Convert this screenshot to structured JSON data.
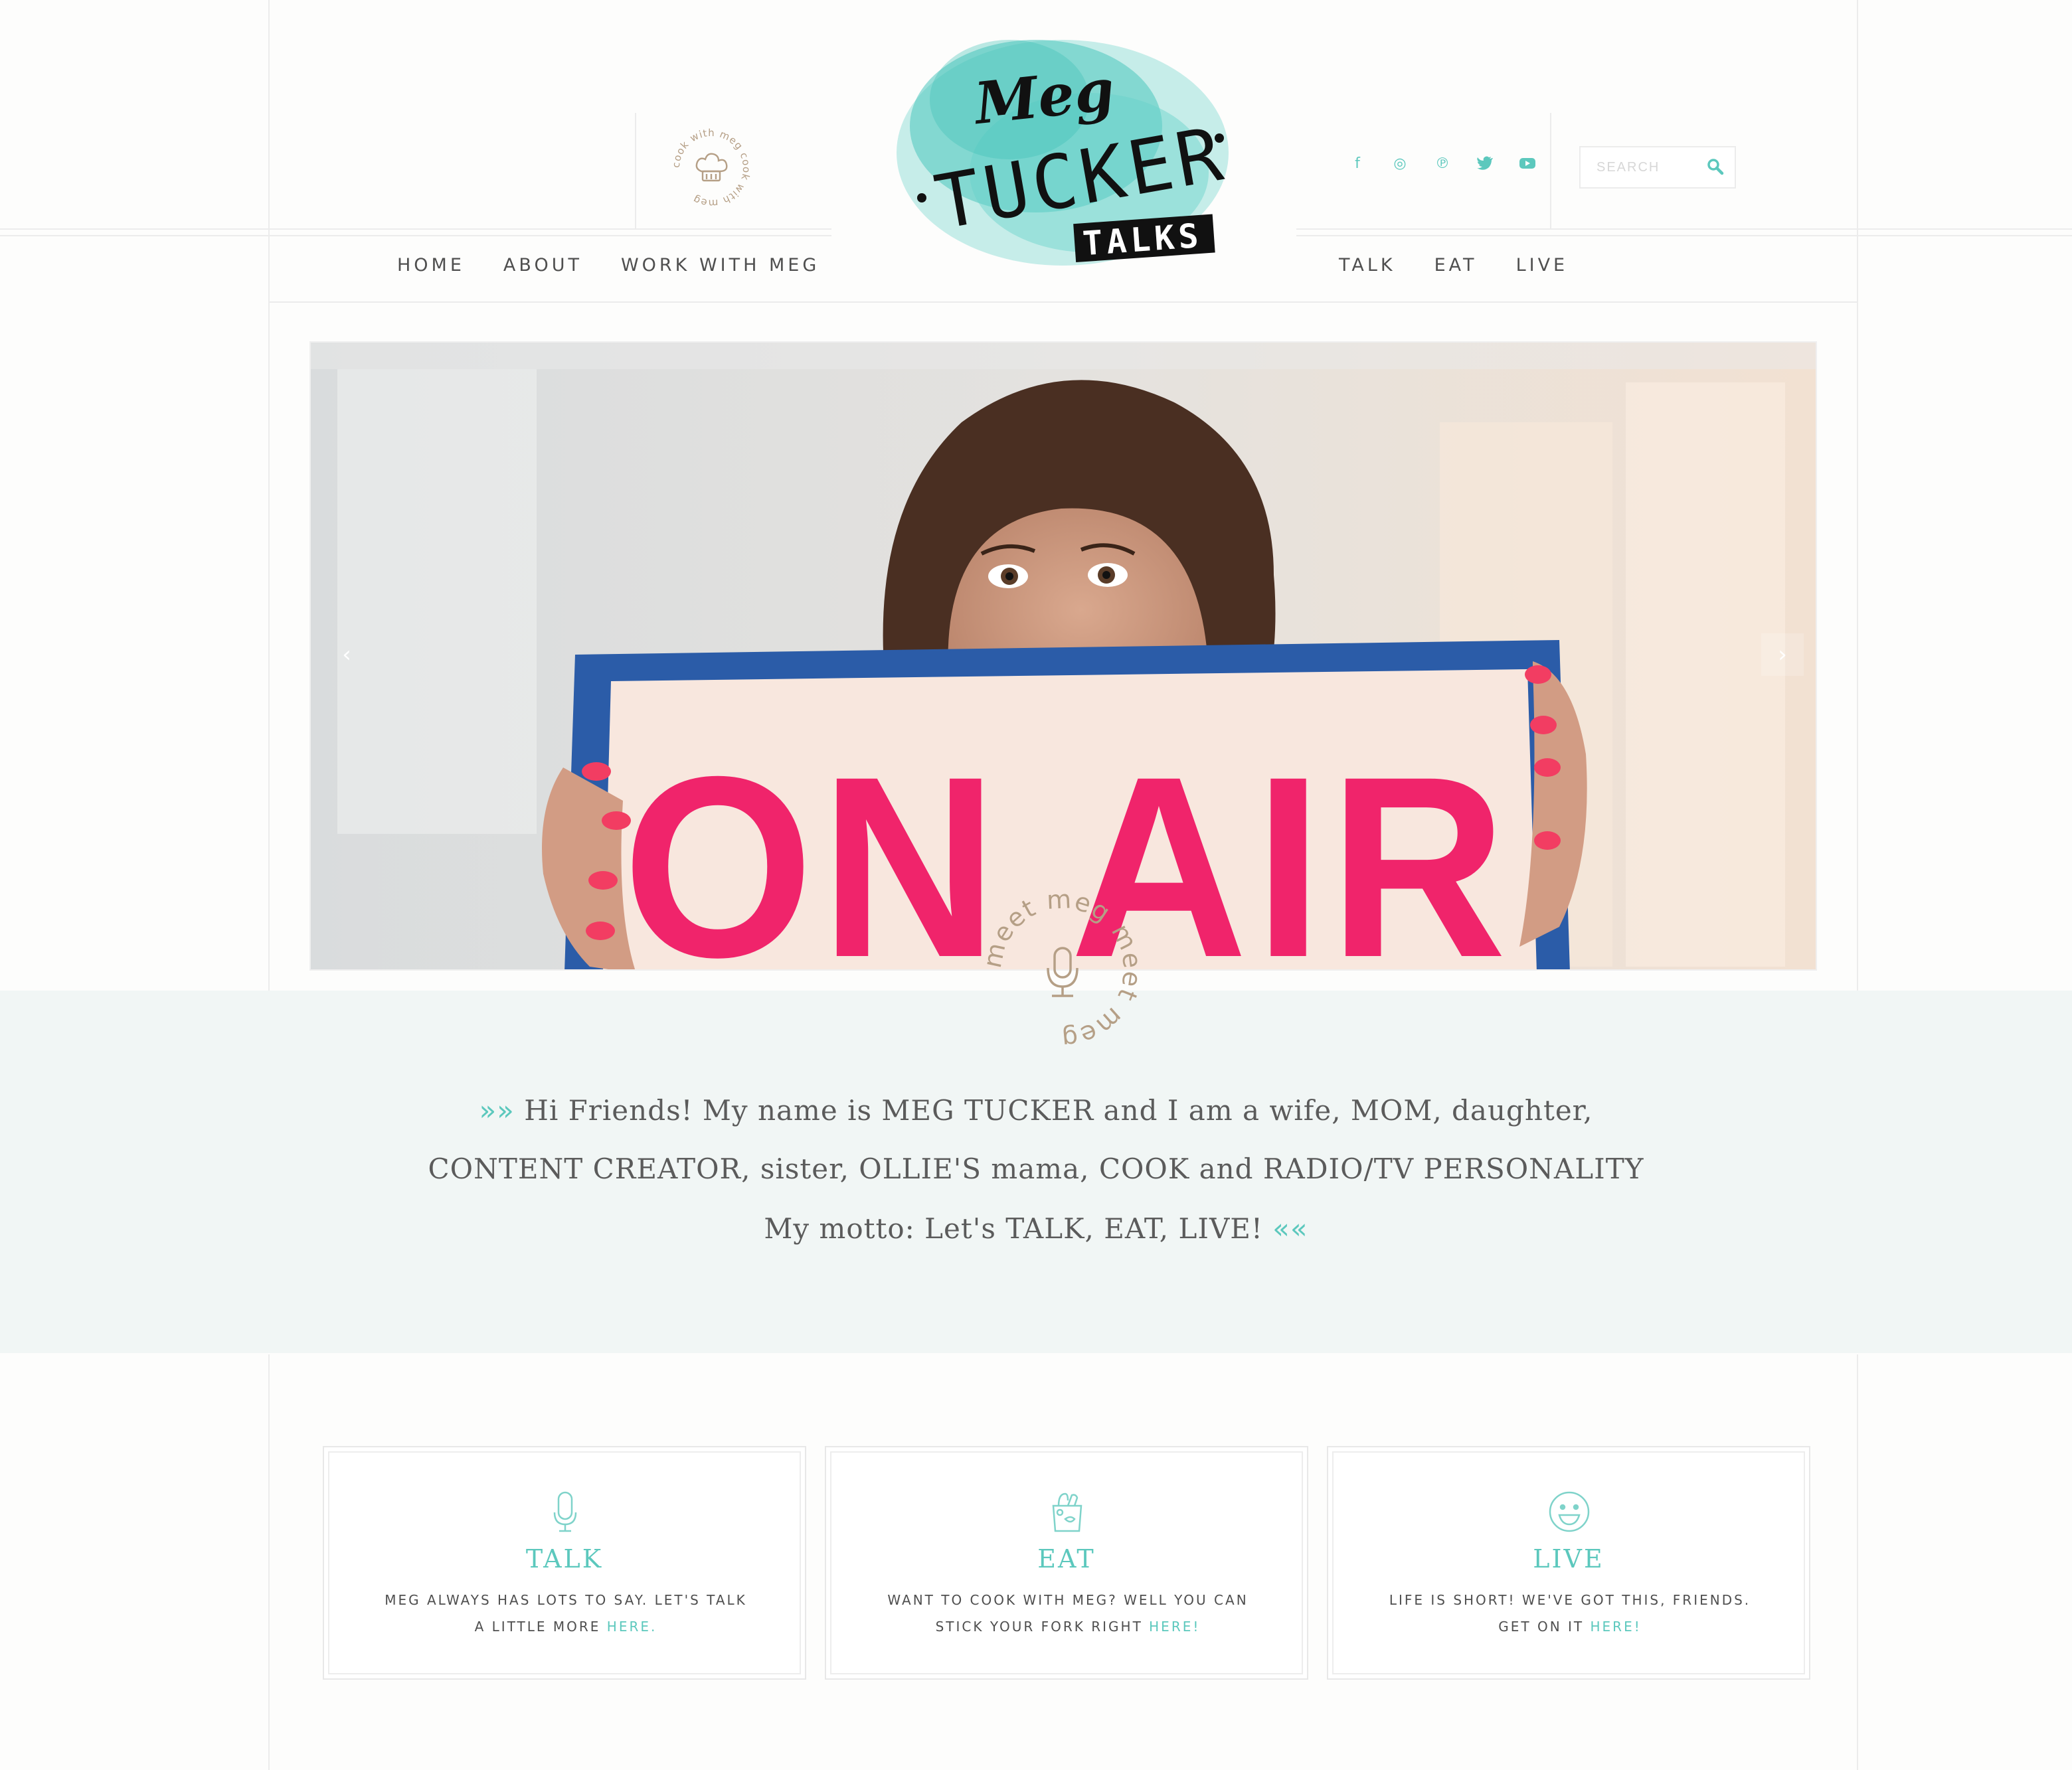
{
  "header": {
    "badge_text": "cook with meg cook with meg",
    "logo": {
      "line1": "Meg",
      "line2": "TUCKER",
      "line3": "TALKS"
    },
    "social": [
      {
        "icon": "facebook-icon",
        "glyph": "f"
      },
      {
        "icon": "instagram-icon",
        "glyph": "◎"
      },
      {
        "icon": "pinterest-icon",
        "glyph": "℗"
      },
      {
        "icon": "twitter-icon",
        "glyph": "🐦"
      },
      {
        "icon": "youtube-icon",
        "glyph": "▶"
      }
    ],
    "search": {
      "placeholder": "SEARCH",
      "value": ""
    },
    "nav_left": [
      "HOME",
      "ABOUT",
      "WORK WITH MEG"
    ],
    "nav_right": [
      "TALK",
      "EAT",
      "LIVE"
    ]
  },
  "hero": {
    "sign_text": "ON AIR",
    "prev_label": "‹",
    "next_label": "›"
  },
  "intro": {
    "badge_text": "meet meg meet meg",
    "open_chevrons": "»»",
    "close_chevrons": "««",
    "line1": " Hi Friends! My name is MEG TUCKER and I am a wife, MOM, daughter,",
    "line2": "CONTENT CREATOR, sister, OLLIE'S mama, COOK and RADIO/TV PERSONALITY",
    "line3": "My motto: Let's TALK, EAT, LIVE! "
  },
  "cards": [
    {
      "icon": "microphone-icon",
      "title": "TALK",
      "text": "MEG ALWAYS HAS LOTS TO SAY. LET'S TALK A LITTLE MORE ",
      "link": "HERE."
    },
    {
      "icon": "grocery-bag-icon",
      "title": "EAT",
      "text": "WANT TO COOK WITH MEG? WELL YOU CAN STICK YOUR FORK RIGHT ",
      "link": "HERE!"
    },
    {
      "icon": "smiley-icon",
      "title": "LIVE",
      "text": "LIFE IS SHORT! WE'VE GOT THIS, FRIENDS. GET ON IT ",
      "link": "HERE!"
    }
  ],
  "colors": {
    "accent": "#5cc8bd",
    "band": "#f1f6f5",
    "sign_pink": "#f0246b",
    "sign_blue": "#2b5ca8",
    "badge_tan": "#b59f86"
  }
}
